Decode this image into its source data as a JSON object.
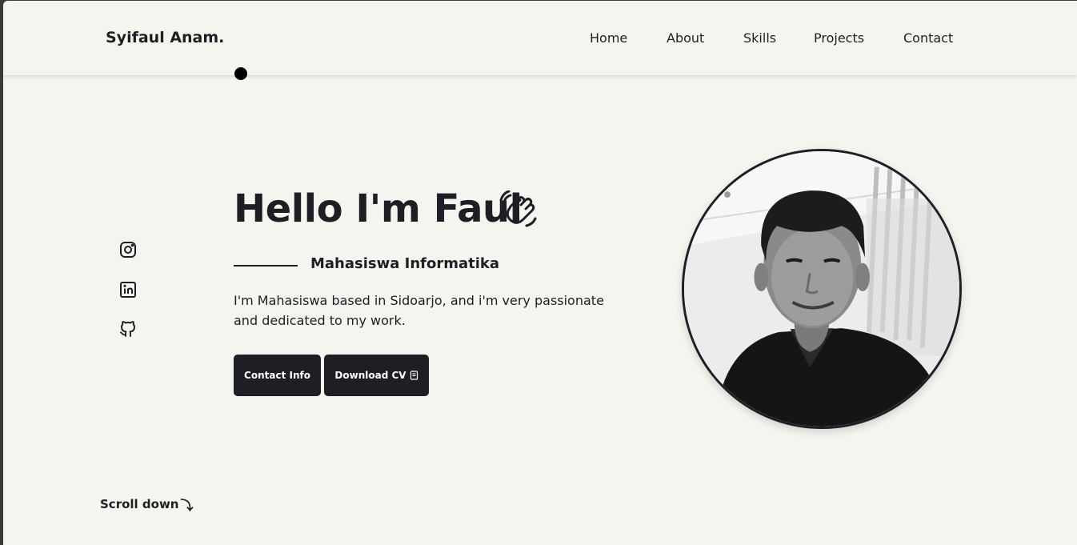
{
  "header": {
    "logo": "Syifaul Anam.",
    "nav": [
      {
        "label": "Home"
      },
      {
        "label": "About"
      },
      {
        "label": "Skills"
      },
      {
        "label": "Projects"
      },
      {
        "label": "Contact"
      }
    ]
  },
  "socials": [
    {
      "name": "instagram-icon"
    },
    {
      "name": "linkedin-icon"
    },
    {
      "name": "github-icon"
    }
  ],
  "hero": {
    "title": "Hello I'm Faul",
    "title_icon": "waving-hand-icon",
    "subtitle": "Mahasiswa Informatika",
    "description": "I'm Mahasiswa based in Sidoarjo, and i'm very passionate and dedicated to my work.",
    "buttons": {
      "contact_label": "Contact Info",
      "cv_label": "Download CV",
      "cv_icon": "document-icon"
    },
    "photo_icon": "profile-photo"
  },
  "scroll": {
    "label": "Scroll down",
    "arrow": "⤵"
  },
  "colors": {
    "background": "#f5f5f0",
    "text": "#1f1e24",
    "button": "#1f1e24"
  }
}
